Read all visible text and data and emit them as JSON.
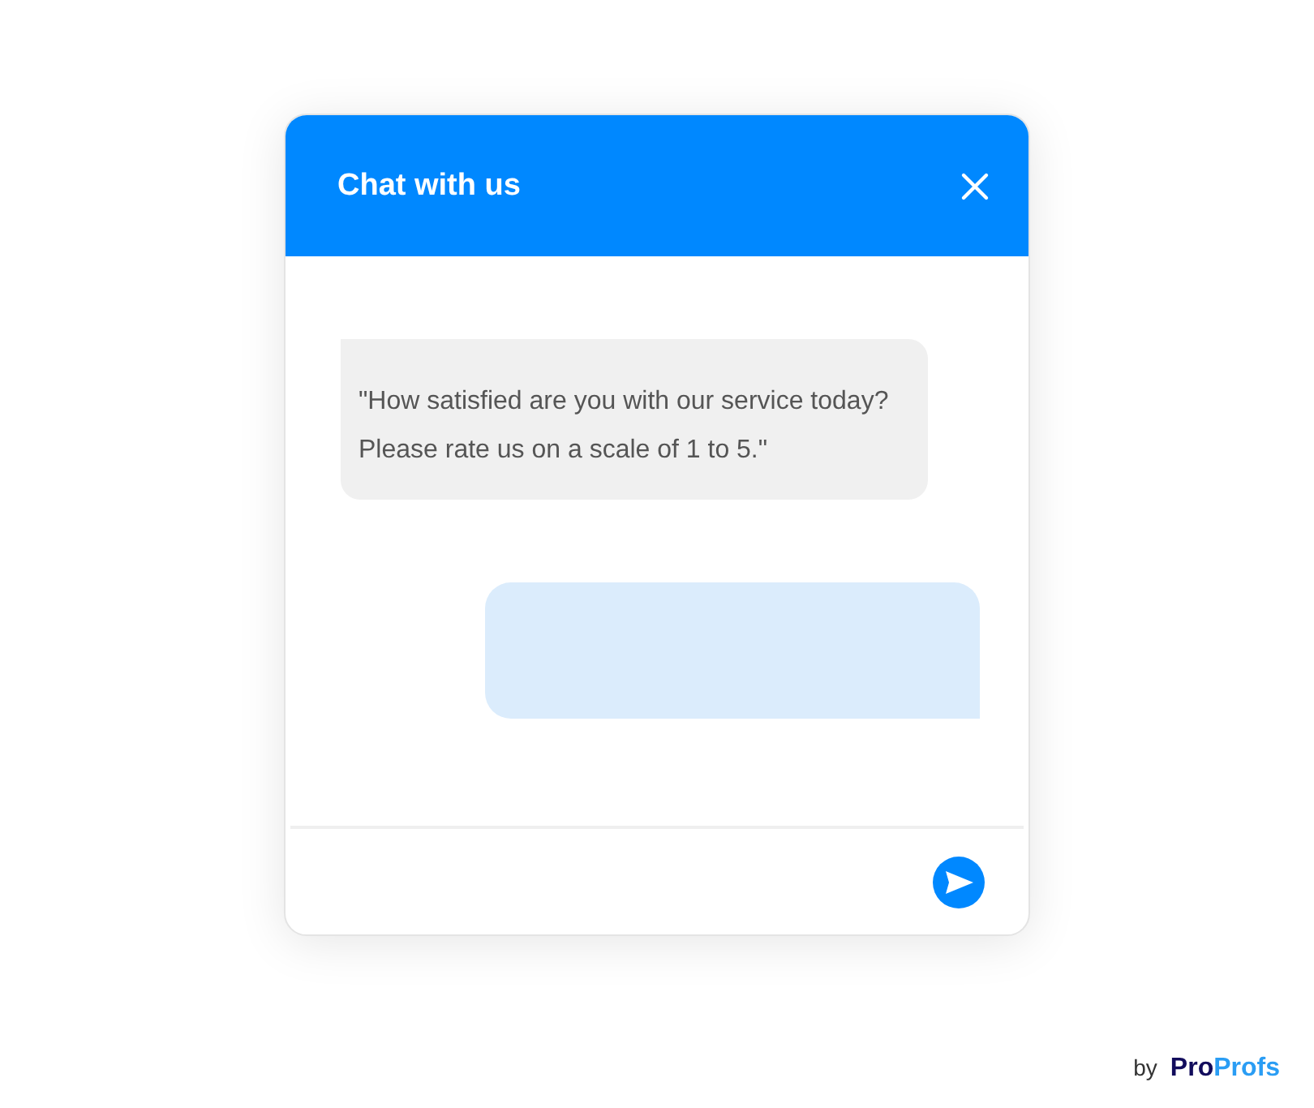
{
  "window": {
    "title": "Chat with us"
  },
  "messages": [
    {
      "kind": "bot",
      "text": "\"How satisfied are you with our service today? Please rate us on a scale of 1 to 5.\""
    },
    {
      "kind": "user"
    }
  ],
  "footer": {
    "by": "by",
    "logo": [
      "Pro",
      "Profs"
    ]
  }
}
